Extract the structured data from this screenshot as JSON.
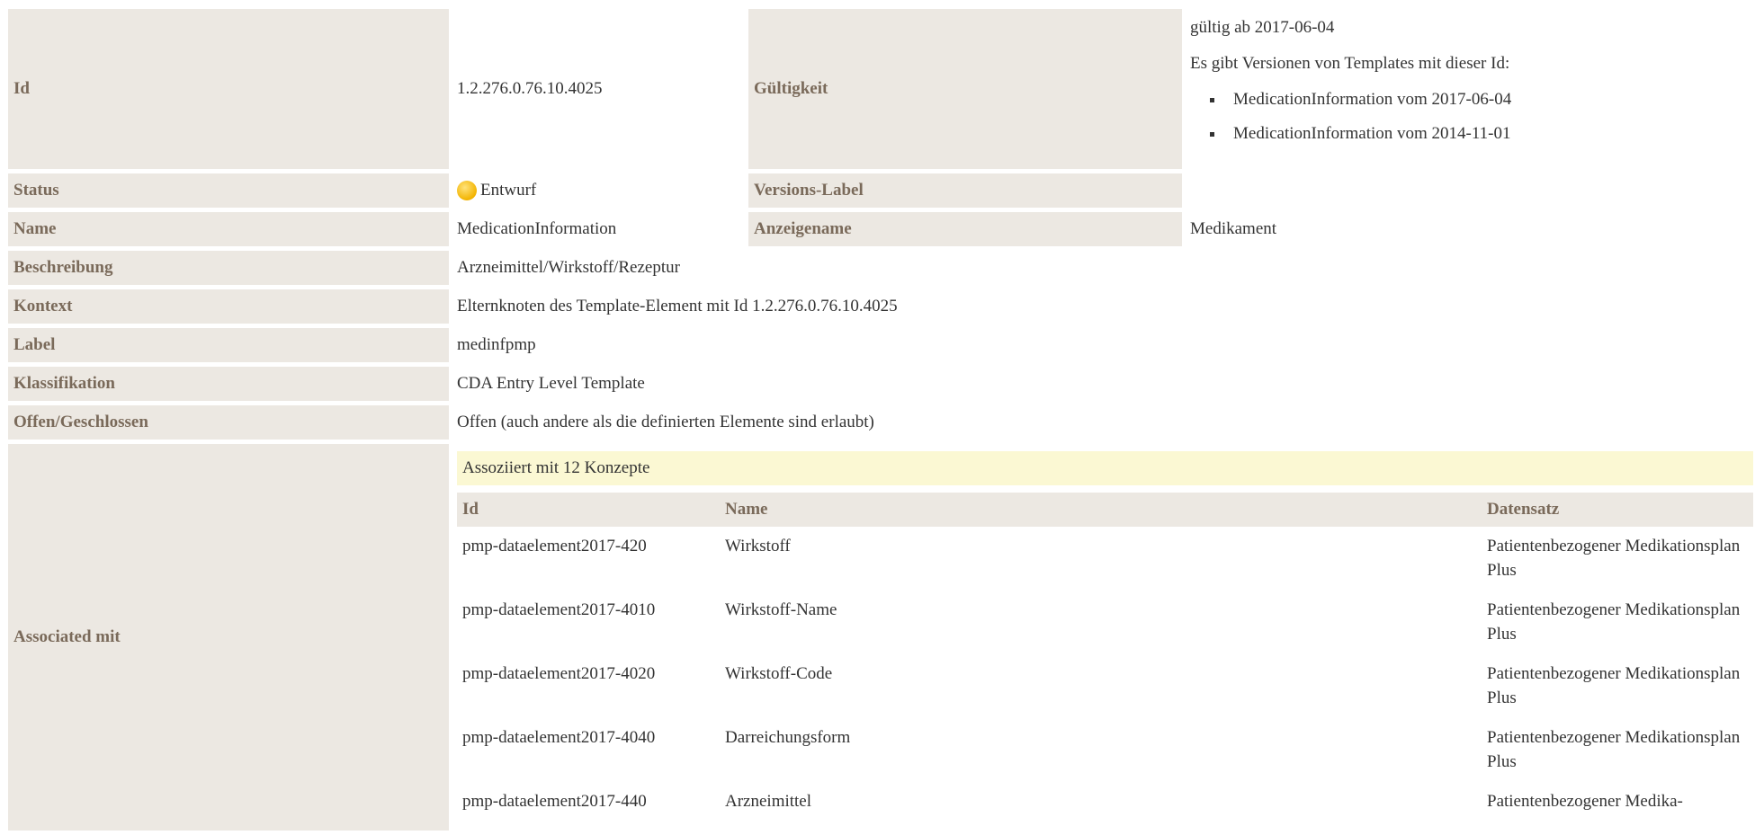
{
  "fields": {
    "id_label": "Id",
    "id_value": "1.2.276.0.76.10.4025",
    "validity_label": "Gültigkeit",
    "validity_from": "gültig ab 2017-06-04",
    "versions_intro": "Es gibt Versionen von Templates mit dieser Id:",
    "versions": [
      "MedicationInformation vom 2017-06-04",
      "MedicationInformation vom 2014-11-01"
    ],
    "status_label": "Status",
    "status_value": "Entwurf",
    "status_icon": "status-draft-icon",
    "version_label_label": "Versions-Label",
    "version_label_value": "",
    "name_label": "Name",
    "name_value": "MedicationInformation",
    "display_name_label": "Anzeigename",
    "display_name_value": "Medikament",
    "description_label": "Beschreibung",
    "description_value": "Arzneimittel/Wirkstoff/Rezeptur",
    "context_label": "Kontext",
    "context_value": "Elternknoten des Template-Element mit Id 1.2.276.0.76.10.4025",
    "label_label": "Label",
    "label_value": "medinfpmp",
    "classification_label": "Klassifikation",
    "classification_value": "CDA Entry Level Template",
    "open_closed_label": "Offen/Geschlossen",
    "open_closed_value": "Offen (auch andere als die definierten Elemente sind erlaubt)",
    "associated_label": "Associated mit"
  },
  "associated": {
    "banner": "Assoziiert mit 12 Konzepte",
    "columns": [
      "Id",
      "Name",
      "Datensatz"
    ],
    "rows": [
      {
        "id": "pmp-dataelement2017-420",
        "name": "Wirkstoff",
        "dataset": "Patientenbezogener Medikationsplan Plus"
      },
      {
        "id": "pmp-dataelement2017-4010",
        "name": "Wirkstoff-Name",
        "dataset": "Patientenbezogener Medikationsplan Plus"
      },
      {
        "id": "pmp-dataelement2017-4020",
        "name": "Wirkstoff-Code",
        "dataset": "Patientenbezogener Medikationsplan Plus"
      },
      {
        "id": "pmp-dataelement2017-4040",
        "name": "Darreichungsform",
        "dataset": "Patientenbezogener Medikationsplan Plus"
      },
      {
        "id": "pmp-dataelement2017-440",
        "name": "Arzneimittel",
        "dataset": "Patientenbezogener Medika-"
      }
    ]
  },
  "colors": {
    "label_bg": "#ece8e2",
    "label_text": "#7a6a5a",
    "banner_bg": "#fbf8d3",
    "status_draft": "#f3b400"
  }
}
